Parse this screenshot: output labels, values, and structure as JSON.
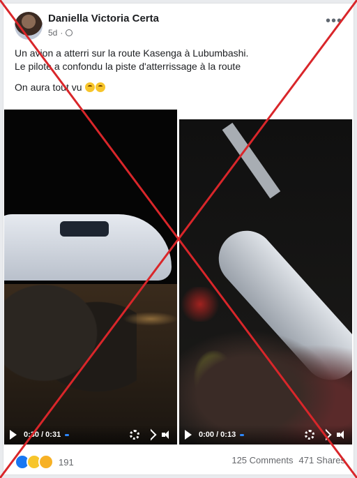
{
  "post": {
    "author": "Daniella Victoria Certa",
    "time": "5d",
    "separator": "·",
    "more_label": "•••",
    "lines": [
      "Un avion a atterri sur la route Kasenga à Lubumbashi.",
      "Le pilote a confondu la piste d'atterrissage à la route"
    ],
    "comment_line": "On aura tout vu"
  },
  "videos": [
    {
      "time": "0:30 / 0:31"
    },
    {
      "time": "0:00 / 0:13"
    }
  ],
  "footer": {
    "reaction_count": "191",
    "comments": "125 Comments",
    "shares": "471 Shares"
  },
  "colors": {
    "accent": "#1877f2",
    "cross": "#d9262a"
  },
  "icons": [
    "globe-icon",
    "more-options-icon",
    "play-icon",
    "settings-icon",
    "fullscreen-icon",
    "volume-icon",
    "like-reaction-icon",
    "haha-reaction-icon",
    "wow-reaction-icon"
  ]
}
